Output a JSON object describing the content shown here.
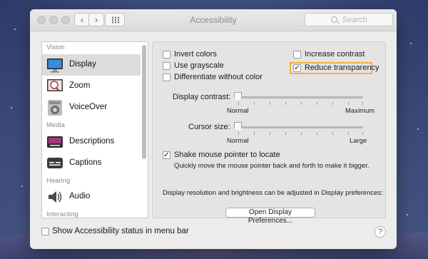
{
  "window": {
    "title": "Accessibility"
  },
  "toolbar": {
    "back_icon": "chevron-left-icon",
    "forward_icon": "chevron-right-icon",
    "back_glyph": "‹",
    "forward_glyph": "›"
  },
  "search": {
    "placeholder": "Search"
  },
  "sidebar": {
    "sections": {
      "vision": "Vision",
      "media": "Media",
      "hearing": "Hearing",
      "interacting": "Interacting"
    },
    "items": [
      {
        "label": "Display",
        "icon": "display-icon",
        "selected": true
      },
      {
        "label": "Zoom",
        "icon": "zoom-icon"
      },
      {
        "label": "VoiceOver",
        "icon": "voiceover-icon"
      },
      {
        "label": "Descriptions",
        "icon": "descriptions-icon"
      },
      {
        "label": "Captions",
        "icon": "captions-icon"
      },
      {
        "label": "Audio",
        "icon": "speaker-icon"
      }
    ]
  },
  "display": {
    "options": {
      "invert_colors": {
        "label": "Invert colors",
        "checked": false
      },
      "use_grayscale": {
        "label": "Use grayscale",
        "checked": false
      },
      "differentiate": {
        "label": "Differentiate without color",
        "checked": false
      },
      "increase_contrast": {
        "label": "Increase contrast",
        "checked": false
      },
      "reduce_transparency": {
        "label": "Reduce transparency",
        "checked": true
      }
    },
    "display_contrast": {
      "label": "Display contrast:",
      "min_label": "Normal",
      "max_label": "Maximum",
      "value": 0
    },
    "cursor_size": {
      "label": "Cursor size:",
      "min_label": "Normal",
      "max_label": "Large",
      "value": 0
    },
    "shake": {
      "label": "Shake mouse pointer to locate",
      "checked": true,
      "description": "Quickly move the mouse pointer back and forth to make it bigger."
    },
    "note": "Display resolution and brightness can be adjusted in Display preferences:",
    "open_button": "Open Display Preferences..."
  },
  "footer": {
    "status_label": "Show Accessibility status in menu bar",
    "status_checked": false,
    "help_glyph": "?"
  },
  "colors": {
    "highlight": "#f0b23a",
    "selected_item": "#dcdcdc"
  }
}
